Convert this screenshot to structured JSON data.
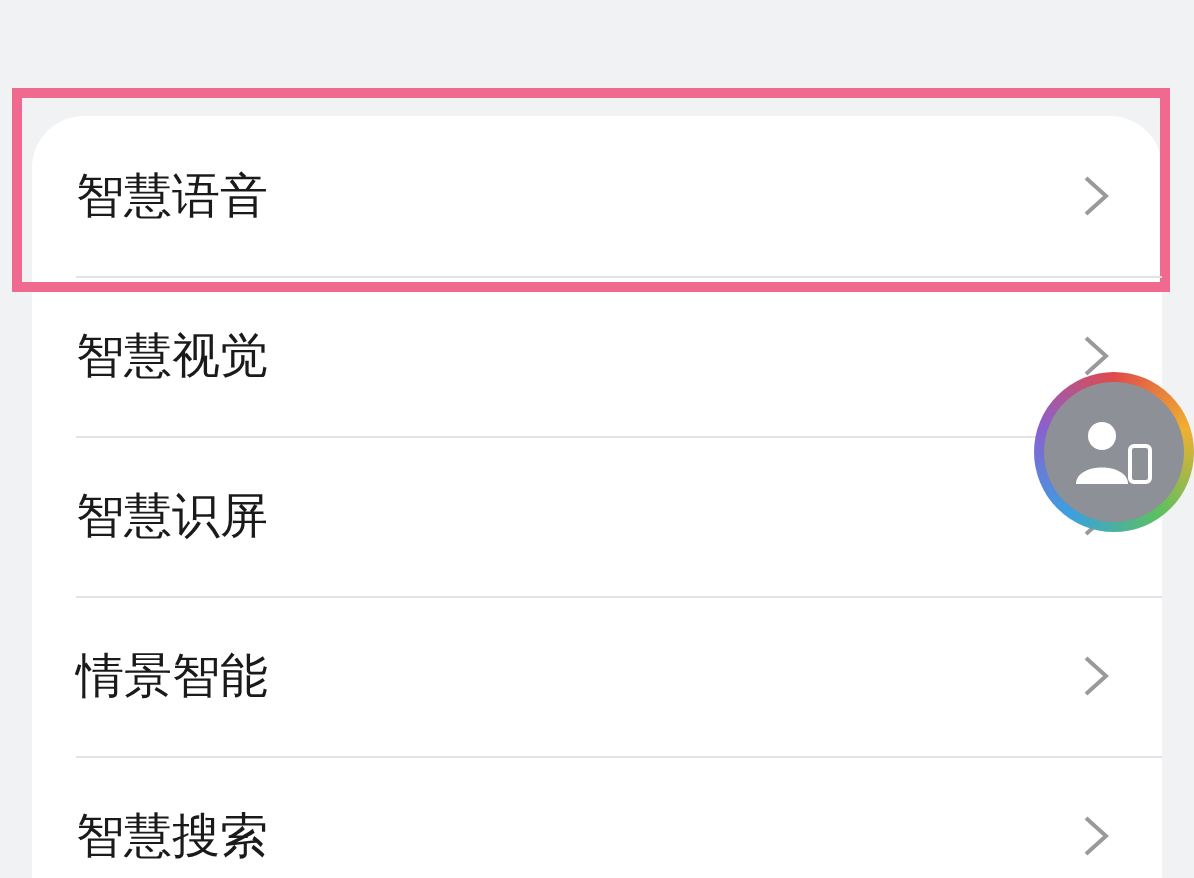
{
  "settings_list": {
    "items": [
      {
        "label": "智慧语音",
        "highlighted": true
      },
      {
        "label": "智慧视觉",
        "highlighted": false
      },
      {
        "label": "智慧识屏",
        "highlighted": false
      },
      {
        "label": "情景智能",
        "highlighted": false
      },
      {
        "label": "智慧搜索",
        "highlighted": false
      }
    ]
  }
}
